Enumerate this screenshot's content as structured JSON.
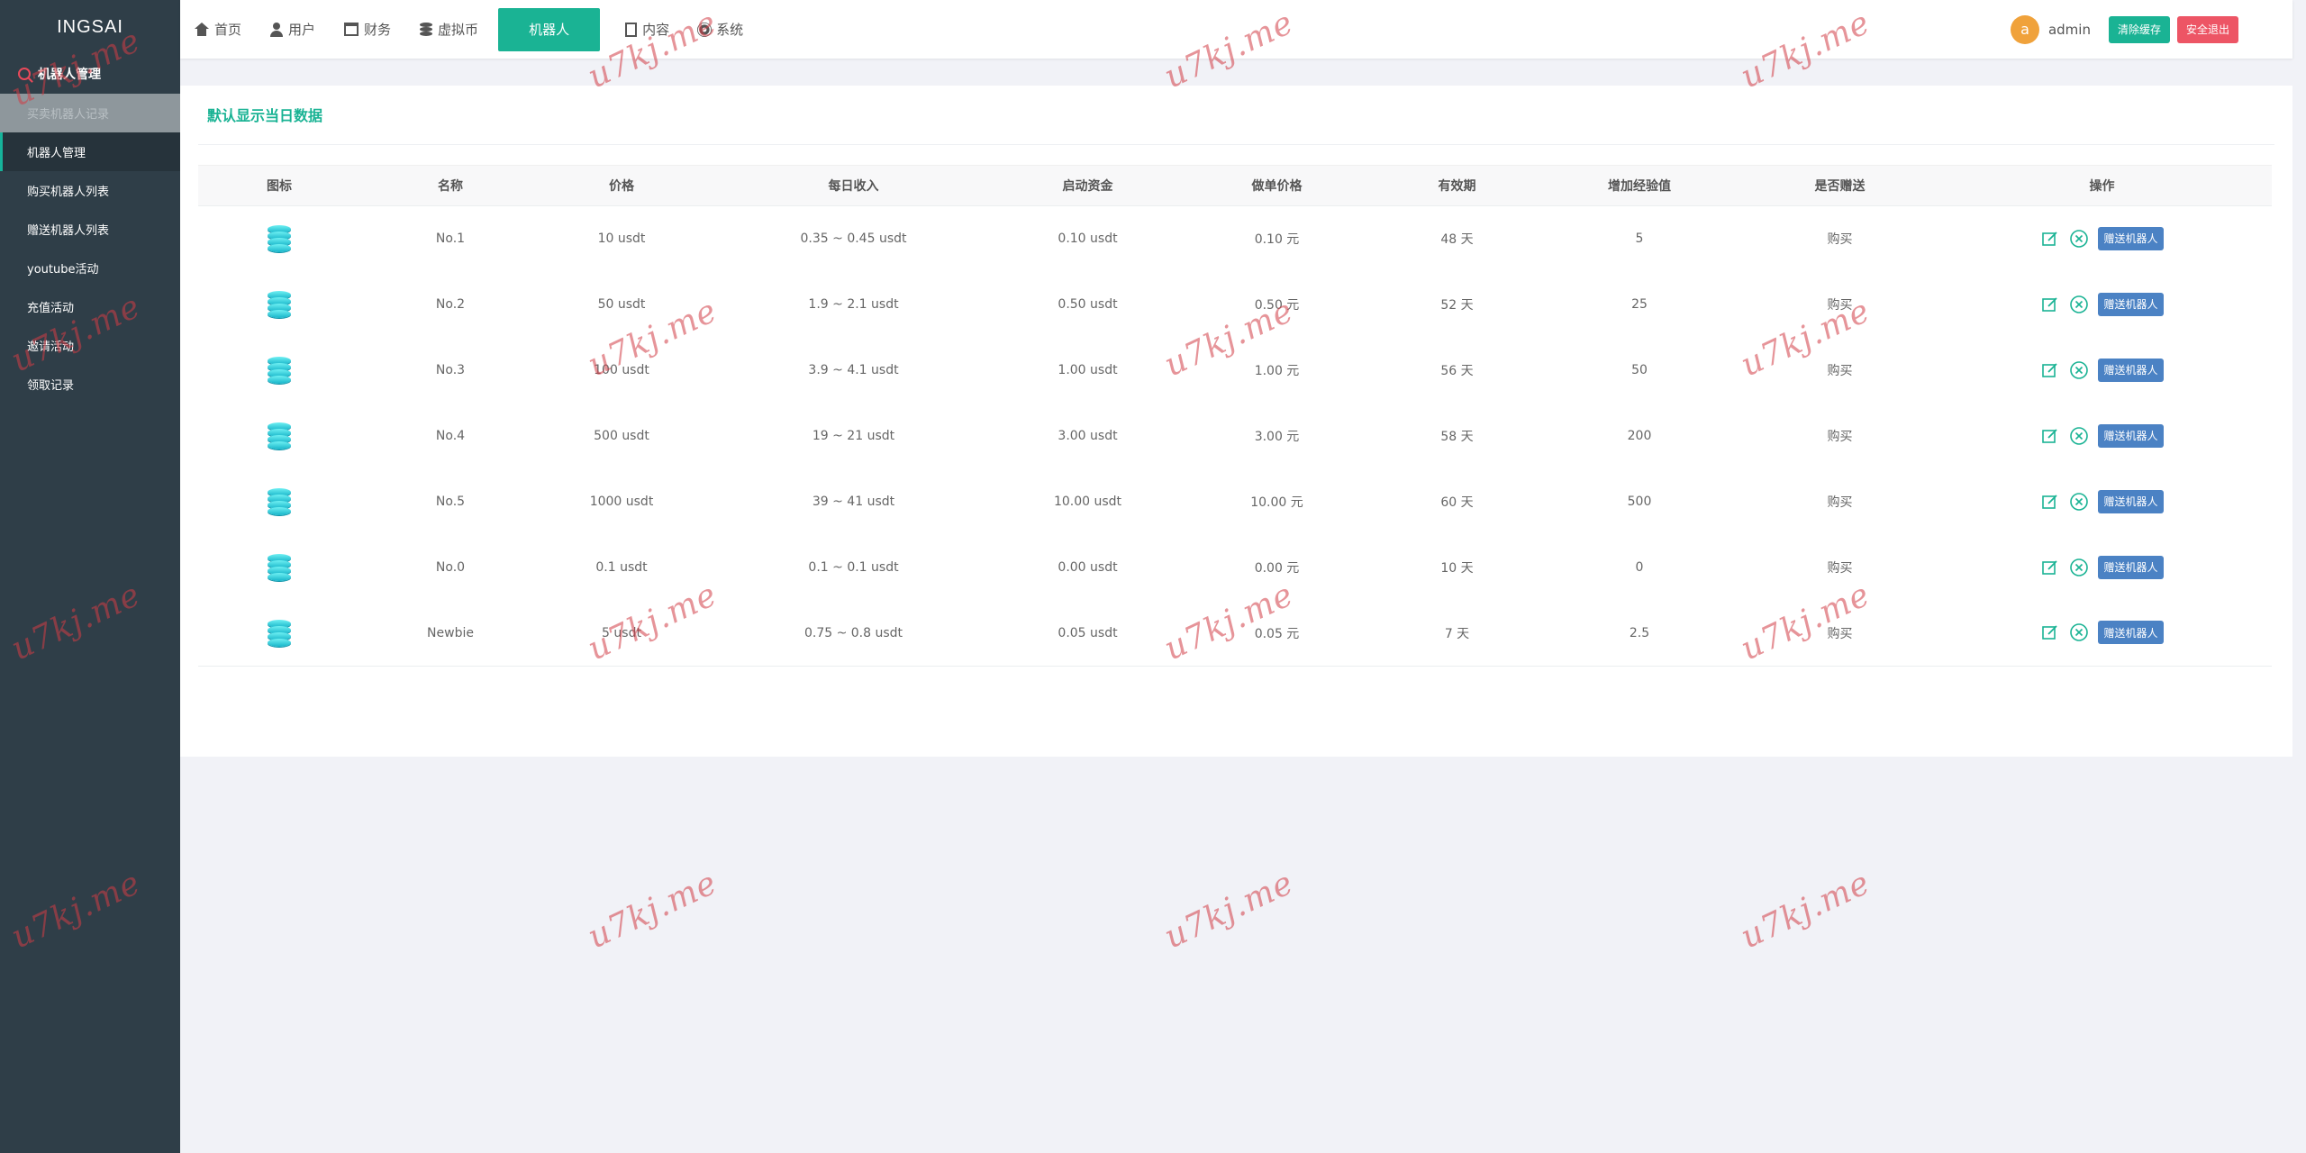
{
  "sidebar": {
    "brand": "INGSAI",
    "group_label": "机器人管理",
    "items": [
      {
        "label": "买卖机器人记录"
      },
      {
        "label": "机器人管理"
      },
      {
        "label": "购买机器人列表"
      },
      {
        "label": "赠送机器人列表"
      },
      {
        "label": "youtube活动"
      },
      {
        "label": "充值活动"
      },
      {
        "label": "邀请活动"
      },
      {
        "label": "领取记录"
      }
    ]
  },
  "topnav": {
    "items": [
      {
        "label": "首页",
        "icon": "home-icon"
      },
      {
        "label": "用户",
        "icon": "user-icon"
      },
      {
        "label": "财务",
        "icon": "finance-icon"
      },
      {
        "label": "虚拟币",
        "icon": "database-icon"
      },
      {
        "label": "机器人",
        "icon": ""
      },
      {
        "label": "内容",
        "icon": "document-icon"
      },
      {
        "label": "系统",
        "icon": "gear-icon"
      }
    ],
    "avatar_letter": "a",
    "username": "admin",
    "clear_cache": "清除缓存",
    "logout": "安全退出"
  },
  "panel": {
    "title": "默认显示当日数据"
  },
  "table": {
    "headers": [
      "图标",
      "名称",
      "价格",
      "每日收入",
      "启动资金",
      "做单价格",
      "有效期",
      "增加经验值",
      "是否赠送",
      "操作"
    ],
    "rows": [
      {
        "name": "No.1",
        "price": "10 usdt",
        "daily": "0.35 ~ 0.45 usdt",
        "start": "0.10 usdt",
        "order": "0.10 元",
        "valid": "48 天",
        "exp": "5",
        "gift": "购买"
      },
      {
        "name": "No.2",
        "price": "50 usdt",
        "daily": "1.9 ~ 2.1 usdt",
        "start": "0.50 usdt",
        "order": "0.50 元",
        "valid": "52 天",
        "exp": "25",
        "gift": "购买"
      },
      {
        "name": "No.3",
        "price": "100 usdt",
        "daily": "3.9 ~ 4.1 usdt",
        "start": "1.00 usdt",
        "order": "1.00 元",
        "valid": "56 天",
        "exp": "50",
        "gift": "购买"
      },
      {
        "name": "No.4",
        "price": "500 usdt",
        "daily": "19 ~ 21 usdt",
        "start": "3.00 usdt",
        "order": "3.00 元",
        "valid": "58 天",
        "exp": "200",
        "gift": "购买"
      },
      {
        "name": "No.5",
        "price": "1000 usdt",
        "daily": "39 ~ 41 usdt",
        "start": "10.00 usdt",
        "order": "10.00 元",
        "valid": "60 天",
        "exp": "500",
        "gift": "购买"
      },
      {
        "name": "No.0",
        "price": "0.1 usdt",
        "daily": "0.1 ~ 0.1 usdt",
        "start": "0.00 usdt",
        "order": "0.00 元",
        "valid": "10 天",
        "exp": "0",
        "gift": "购买"
      },
      {
        "name": "Newbie",
        "price": "5 usdt",
        "daily": "0.75 ~ 0.8 usdt",
        "start": "0.05 usdt",
        "order": "0.05 元",
        "valid": "7 天",
        "exp": "2.5",
        "gift": "购买"
      }
    ],
    "gift_button": "赠送机器人"
  },
  "watermark": "u7kj.me",
  "colors": {
    "accent": "#1ab394",
    "danger": "#ed5565",
    "sidebar": "#2f3e48",
    "gift_button": "#4b82c4"
  }
}
